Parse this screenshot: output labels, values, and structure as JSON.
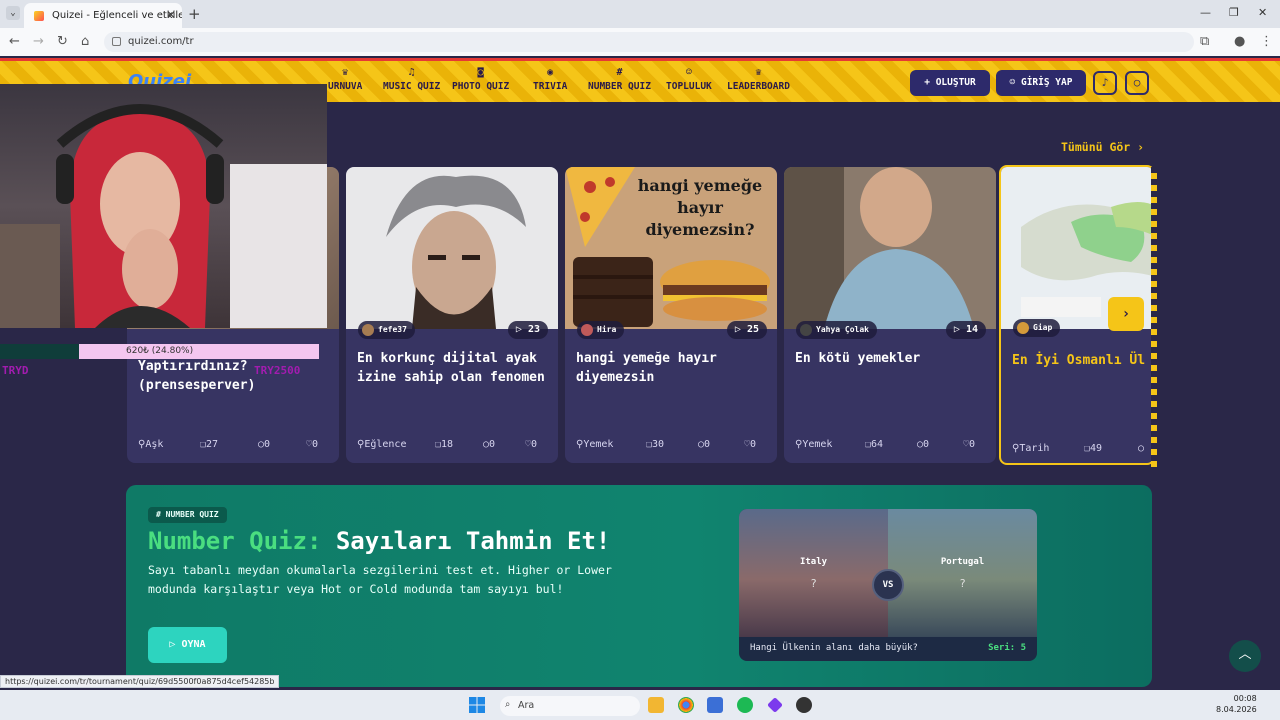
{
  "browser": {
    "tab_title": "Quizei - Eğlenceli ve etkileşimli",
    "url": "quizei.com/tr",
    "status_url": "https://quizei.com/tr/tournament/quiz/69d5500f0a875d4cef54285b"
  },
  "header": {
    "logo": "Quizei",
    "nav": [
      {
        "label": "URNUVA",
        "icon": "trophy-icon"
      },
      {
        "label": "MUSIC QUIZ",
        "icon": "music-icon"
      },
      {
        "label": "PHOTO QUIZ",
        "icon": "camera-icon"
      },
      {
        "label": "TRIVIA",
        "icon": "chat-icon"
      },
      {
        "label": "NUMBER QUIZ",
        "icon": "hash-icon"
      },
      {
        "label": "TOPLULUK",
        "icon": "users-icon"
      },
      {
        "label": "LEADERBOARD",
        "icon": "trophy-icon"
      }
    ],
    "create_label": "+ OLUŞTUR",
    "login_label": "GİRİŞ YAP"
  },
  "section": {
    "see_all": "Tümünü Gör ›"
  },
  "cards": [
    {
      "author": "",
      "plays": "",
      "title": "Yaptırırdınız? (prensesperver)",
      "category": "Aşk",
      "questions": "27",
      "comments": "0",
      "likes": "0"
    },
    {
      "author": "fefe37",
      "plays": "23",
      "title": "En korkunç dijital ayak izine sahip olan fenomen",
      "category": "Eğlence",
      "questions": "18",
      "comments": "0",
      "likes": "0"
    },
    {
      "author": "Hira",
      "plays": "25",
      "title": "hangi yemeğe hayır diyemezsin",
      "category": "Yemek",
      "questions": "30",
      "comments": "0",
      "likes": "0",
      "image_text": "hangi yemeğe hayır diyemezsin?"
    },
    {
      "author": "Yahya Çolak",
      "plays": "14",
      "title": "En kötü yemekler",
      "category": "Yemek",
      "questions": "64",
      "comments": "0",
      "likes": "0"
    },
    {
      "author": "Giap",
      "plays": "",
      "title": "En İyi Osmanlı Ül",
      "category": "Tarih",
      "questions": "49",
      "comments": "",
      "likes": ""
    }
  ],
  "banner": {
    "badge": "# NUMBER QUIZ",
    "title_accent": "Number Quiz:",
    "title_rest": "Sayıları Tahmin Et!",
    "description": "Sayı tabanlı meydan okumalarla sezgilerini test et. Higher or Lower modunda karşılaştır veya Hot or Cold modunda tam sayıyı bul!",
    "play_label": "OYNA",
    "game": {
      "left_country": "Italy",
      "right_country": "Portugal",
      "left_value": "?",
      "right_value": "?",
      "vs": "VS",
      "question": "Hangi Ülkenin alanı daha büyük?",
      "streak": "Seri: 5"
    }
  },
  "stream_overlay": {
    "donation": "620₺ (24.80%)",
    "donation_progress": 0.248,
    "ticker_left": "TRYD",
    "ticker_right": "TRY2500"
  },
  "taskbar": {
    "search_placeholder": "Ara",
    "time": "00:08",
    "date": "8.04.2026"
  },
  "colors": {
    "accent_yellow": "#f5c518",
    "page_bg": "#2a2748",
    "card_bg": "#373462",
    "banner_green": "#10846f",
    "accent_green": "#4ade80"
  }
}
